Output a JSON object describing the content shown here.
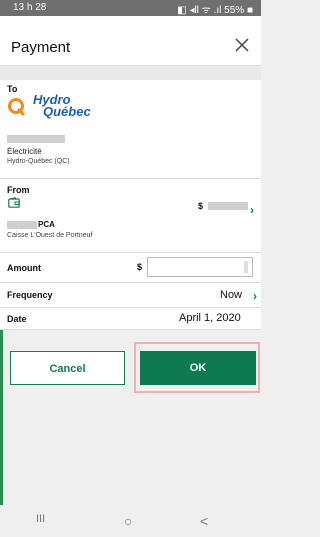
{
  "statusbar": {
    "time": "13 h 28",
    "icons": "◧ ◂ll ᯤ .ıl 55% ■"
  },
  "header": {
    "title": "Payment",
    "close_label": "×"
  },
  "to": {
    "label": "To",
    "logo_line1": "Hydro",
    "logo_line2": "Québec",
    "payee_type": "Électricité",
    "payee_name": "Hydro-Québec (QC)"
  },
  "from": {
    "label": "From",
    "currency_symbol": "$",
    "account_suffix": "PCA",
    "institution": "Caisse L'Ouest de Portneuf"
  },
  "amount": {
    "label": "Amount",
    "currency_symbol": "$"
  },
  "frequency": {
    "label": "Frequency",
    "value": "Now"
  },
  "date": {
    "label": "Date",
    "value": "April 1, 2020"
  },
  "buttons": {
    "cancel": "Cancel",
    "ok": "OK"
  },
  "navbar": {
    "recents": "III",
    "home": "○",
    "back": "<"
  },
  "colors": {
    "accent": "#0f7a52",
    "brand_blue": "#1b5fb5",
    "brand_orange": "#f28a1c",
    "highlight": "#f0b0b0"
  }
}
